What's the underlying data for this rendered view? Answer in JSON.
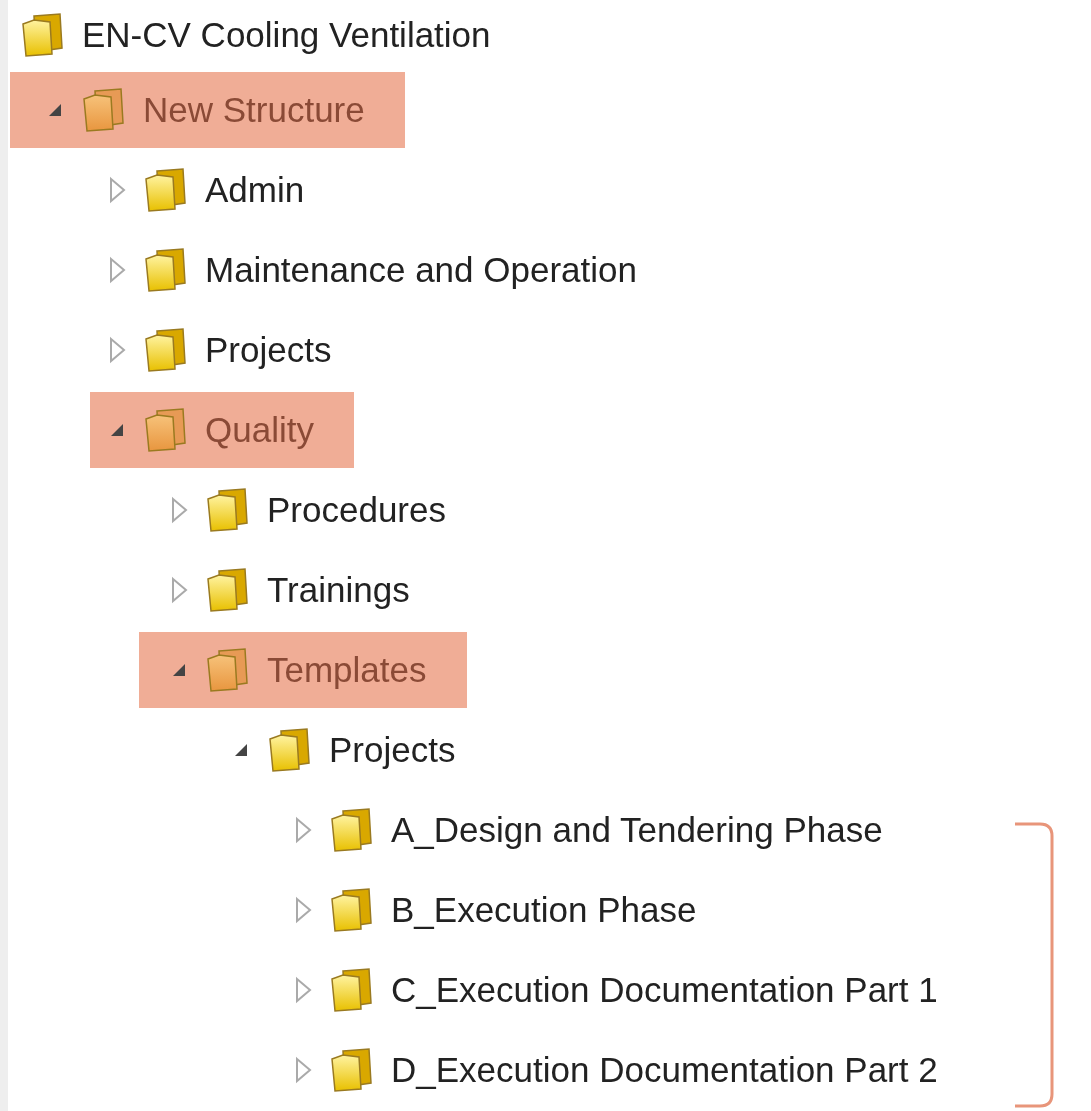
{
  "tree": [
    {
      "label": "EN-CV Cooling Ventilation",
      "highlighted": false,
      "children": [
        {
          "label": "New Structure",
          "expanded": true,
          "highlighted": true,
          "children": [
            {
              "label": "Admin",
              "expanded": false,
              "highlighted": false
            },
            {
              "label": "Maintenance and Operation",
              "expanded": false,
              "highlighted": false
            },
            {
              "label": "Projects",
              "expanded": false,
              "highlighted": false
            },
            {
              "label": "Quality",
              "expanded": true,
              "highlighted": true,
              "children": [
                {
                  "label": "Procedures",
                  "expanded": false,
                  "highlighted": false
                },
                {
                  "label": "Trainings",
                  "expanded": false,
                  "highlighted": false
                },
                {
                  "label": "Templates",
                  "expanded": true,
                  "highlighted": true,
                  "children": [
                    {
                      "label": "Projects",
                      "expanded": true,
                      "highlighted": false,
                      "children": [
                        {
                          "label": "A_Design and Tendering Phase",
                          "expanded": false,
                          "highlighted": false
                        },
                        {
                          "label": "B_Execution Phase",
                          "expanded": false,
                          "highlighted": false
                        },
                        {
                          "label": "C_Execution Documentation Part 1",
                          "expanded": false,
                          "highlighted": false
                        },
                        {
                          "label": "D_Execution Documentation Part 2",
                          "expanded": false,
                          "highlighted": false
                        }
                      ]
                    }
                  ]
                }
              ]
            }
          ]
        }
      ]
    }
  ],
  "bracket": {
    "shown": true
  }
}
